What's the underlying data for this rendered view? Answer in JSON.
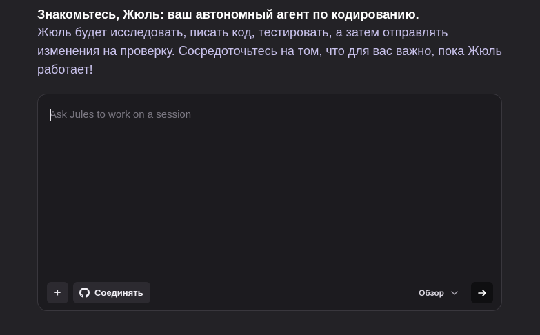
{
  "intro": {
    "title": "Знакомьтесь, Жюль: ваш автономный агент по кодированию.",
    "subtitle": "Жюль будет исследовать, писать код, тестировать, а затем отправлять изменения на проверку. Сосредоточьтесь на том, что для вас важно, пока Жюль работает!"
  },
  "composer": {
    "placeholder": "Ask Jules to work on a session",
    "value": "",
    "add_icon": "plus-icon",
    "connect_label": "Соединять",
    "connect_icon": "github-icon",
    "view_label": "Обзор",
    "view_icon": "chevron-down-icon",
    "send_icon": "arrow-right-icon"
  },
  "colors": {
    "background": "#232226",
    "composer_background": "#1c1b1f",
    "subtitle_text": "#c9c2ec",
    "title_text": "#ffffff",
    "button_background": "#2c2a30",
    "send_button_background": "#0f0f11"
  }
}
